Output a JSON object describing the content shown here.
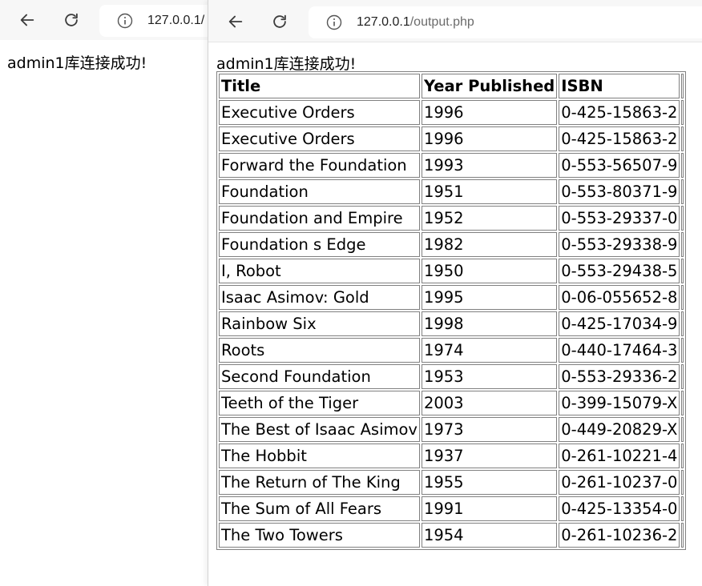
{
  "back_window": {
    "url": "127.0.0.1/",
    "message": "admin1库连接成功!"
  },
  "front_window": {
    "url_host": "127.0.0.1",
    "url_path": "/output.php",
    "message": "admin1库连接成功!",
    "table": {
      "headers": [
        "Title",
        "Year Published",
        "ISBN"
      ],
      "rows": [
        [
          "Executive Orders",
          "1996",
          "0-425-15863-2"
        ],
        [
          "Executive Orders",
          "1996",
          "0-425-15863-2"
        ],
        [
          "Forward the Foundation",
          "1993",
          "0-553-56507-9"
        ],
        [
          "Foundation",
          "1951",
          "0-553-80371-9"
        ],
        [
          "Foundation and Empire",
          "1952",
          "0-553-29337-0"
        ],
        [
          "Foundation s Edge",
          "1982",
          "0-553-29338-9"
        ],
        [
          "I, Robot",
          "1950",
          "0-553-29438-5"
        ],
        [
          "Isaac Asimov: Gold",
          "1995",
          "0-06-055652-8"
        ],
        [
          "Rainbow Six",
          "1998",
          "0-425-17034-9"
        ],
        [
          "Roots",
          "1974",
          "0-440-17464-3"
        ],
        [
          "Second Foundation",
          "1953",
          "0-553-29336-2"
        ],
        [
          "Teeth of the Tiger",
          "2003",
          "0-399-15079-X"
        ],
        [
          "The Best of Isaac Asimov",
          "1973",
          "0-449-20829-X"
        ],
        [
          "The Hobbit",
          "1937",
          "0-261-10221-4"
        ],
        [
          "The Return of The King",
          "1955",
          "0-261-10237-0"
        ],
        [
          "The Sum of All Fears",
          "1991",
          "0-425-13354-0"
        ],
        [
          "The Two Towers",
          "1954",
          "0-261-10236-2"
        ]
      ]
    }
  },
  "icons": {
    "back": "arrow-left-icon",
    "reload": "reload-icon",
    "info": "info-circle-icon"
  }
}
